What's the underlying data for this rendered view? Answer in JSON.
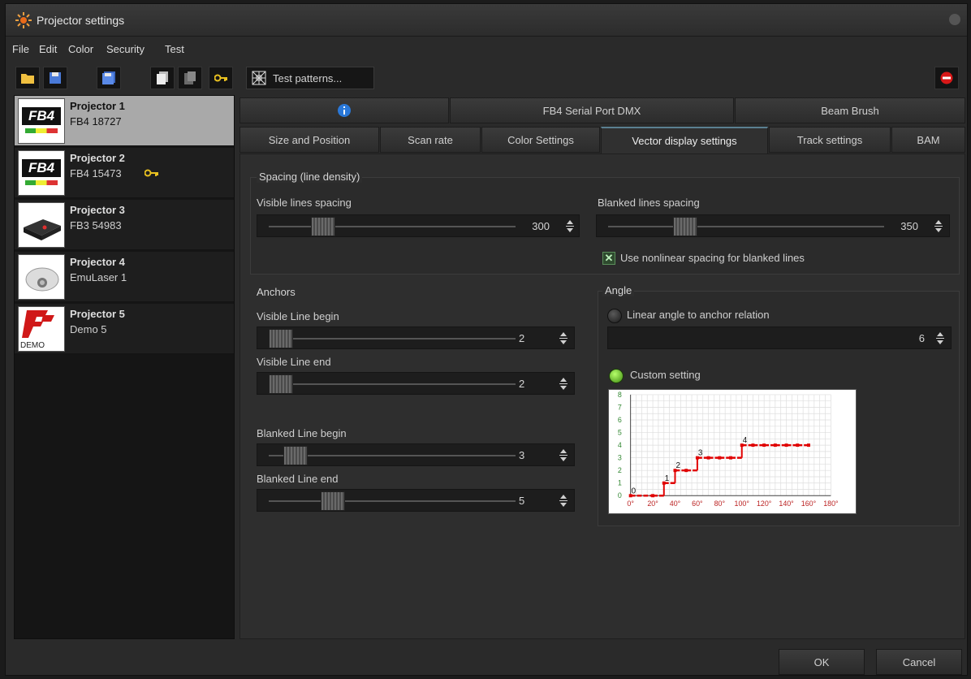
{
  "window": {
    "title": "Projector settings"
  },
  "menu": [
    "File",
    "Edit",
    "Color",
    "Security",
    "Test"
  ],
  "toolbar": {
    "test_patterns_label": "Test patterns..."
  },
  "projectors": [
    {
      "name": "Projector 1",
      "serial": "FB4 18727",
      "thumb": "FB4"
    },
    {
      "name": "Projector 2",
      "serial": "FB4 15473",
      "thumb": "FB4"
    },
    {
      "name": "Projector 3",
      "serial": "FB3 54983",
      "thumb": ""
    },
    {
      "name": "Projector 4",
      "serial": "EmuLaser 1",
      "thumb": ""
    },
    {
      "name": "Projector 5",
      "serial": "Demo 5",
      "thumb": "DEMO"
    }
  ],
  "tabs_row1": [
    "",
    "FB4 Serial Port DMX",
    "Beam Brush"
  ],
  "tabs_row2": [
    "Size and Position",
    "Scan rate",
    "Color Settings",
    "Vector display settings",
    "Track settings",
    "BAM"
  ],
  "spacing": {
    "title": "Spacing (line density)",
    "visible_label": "Visible lines spacing",
    "visible_value": "300",
    "blanked_label": "Blanked lines spacing",
    "blanked_value": "350",
    "nonlinear_label": "Use nonlinear spacing for blanked lines"
  },
  "anchors": {
    "title": "Anchors",
    "visible_begin_label": "Visible Line begin",
    "visible_begin_value": "2",
    "visible_end_label": "Visible Line end",
    "visible_end_value": "2",
    "blanked_begin_label": "Blanked Line begin",
    "blanked_begin_value": "3",
    "blanked_end_label": "Blanked Line end",
    "blanked_end_value": "5"
  },
  "angle": {
    "title": "Angle",
    "linear_label": "Linear angle to anchor relation",
    "linear_value": "6",
    "custom_label": "Custom setting"
  },
  "chart_data": {
    "type": "line",
    "title": "",
    "xlabel": "",
    "ylabel": "",
    "x_ticks": [
      "0°",
      "20°",
      "40°",
      "60°",
      "80°",
      "100°",
      "120°",
      "140°",
      "160°",
      "180°"
    ],
    "y_ticks": [
      "0",
      "1",
      "2",
      "3",
      "4",
      "5",
      "6",
      "7",
      "8"
    ],
    "ylim": [
      0,
      8
    ],
    "xlim": [
      0,
      180
    ],
    "x": [
      0,
      20,
      30,
      40,
      50,
      60,
      70,
      80,
      90,
      100,
      110,
      120,
      130,
      140,
      150,
      160
    ],
    "series": [
      {
        "values": [
          0,
          0,
          1,
          2,
          2,
          3,
          3,
          3,
          3,
          4,
          4,
          4,
          4,
          4,
          4,
          4
        ]
      }
    ],
    "point_labels": [
      {
        "x": 0,
        "label": "0"
      },
      {
        "x": 30,
        "label": "1"
      },
      {
        "x": 40,
        "label": "2"
      },
      {
        "x": 60,
        "label": "3"
      },
      {
        "x": 100,
        "label": "4"
      }
    ],
    "grid": true,
    "line_color": "#e00000"
  },
  "buttons": {
    "ok": "OK",
    "cancel": "Cancel"
  }
}
